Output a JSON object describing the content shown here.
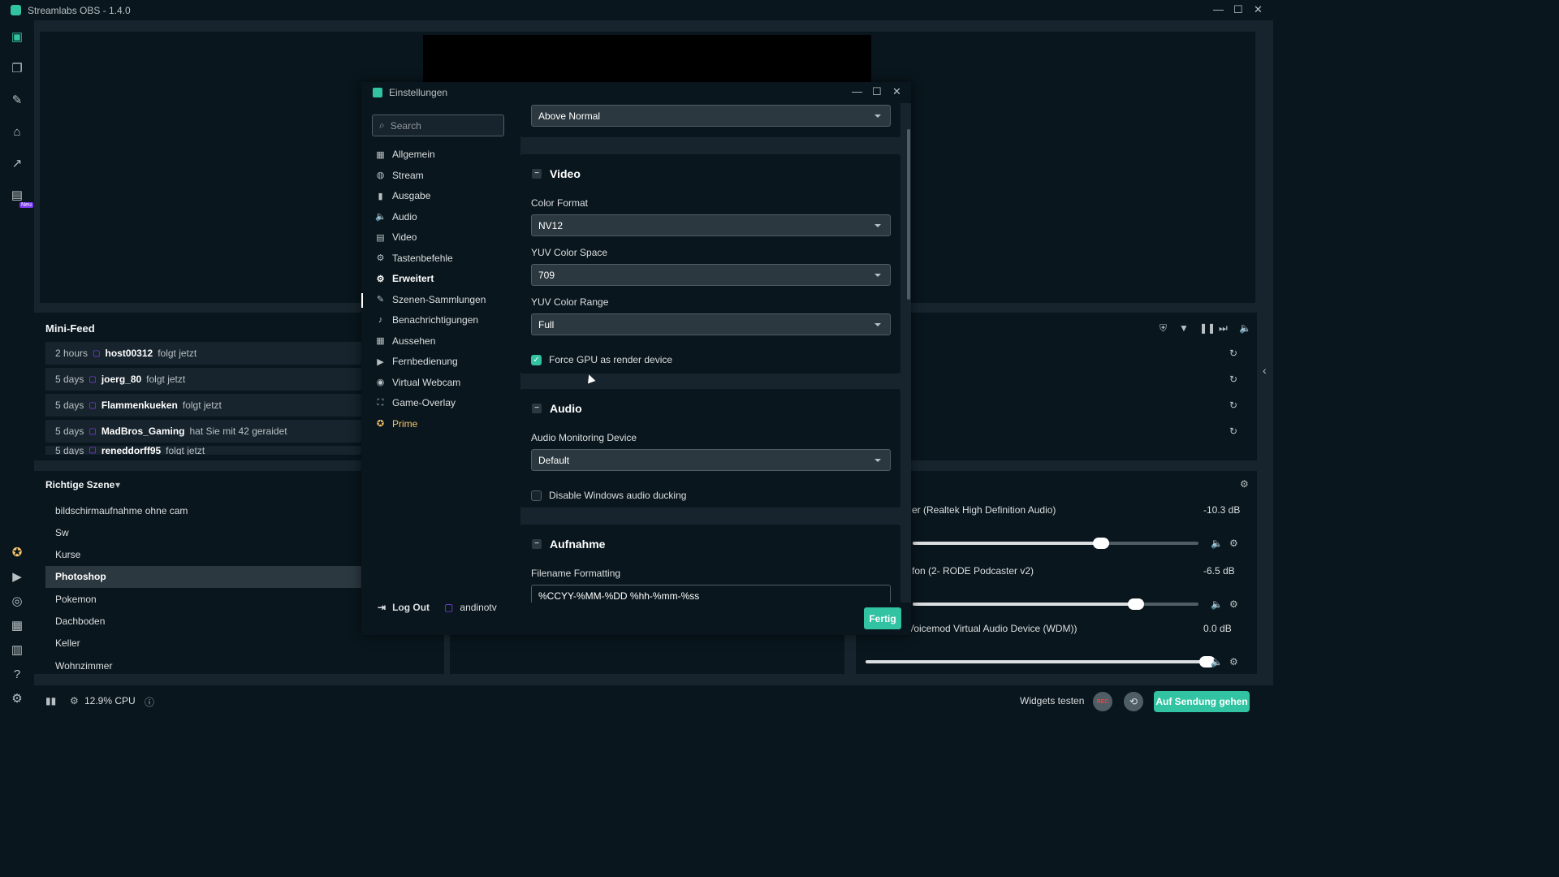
{
  "app": {
    "title": "Streamlabs OBS - 1.4.0"
  },
  "leftbar": {
    "new_badge": "Neu"
  },
  "minifeed": {
    "title": "Mini-Feed",
    "rows": [
      {
        "time": "2 hours",
        "user": "host00312",
        "action": "folgt jetzt"
      },
      {
        "time": "5 days",
        "user": "joerg_80",
        "action": "folgt jetzt"
      },
      {
        "time": "5 days",
        "user": "Flammenkueken",
        "action": "folgt jetzt"
      },
      {
        "time": "5 days",
        "user": "MadBros_Gaming",
        "action": "hat Sie mit 42 geraidet"
      },
      {
        "time": "5 days",
        "user": "reneddorff95",
        "action": "folgt jetzt"
      }
    ]
  },
  "scenes": {
    "title": "Richtige Szene",
    "items": [
      "bildschirmaufnahme ohne cam",
      "Sw",
      "Kurse",
      "Photoshop",
      "Pokemon",
      "Dachboden",
      "Keller",
      "Wohnzimmer"
    ],
    "active": "Photoshop"
  },
  "mixer": {
    "sources": [
      {
        "name": "er (Realtek High Definition Audio)",
        "db": "-10.3 dB",
        "level": 0.66
      },
      {
        "name": "fon (2- RODE Podcaster v2)",
        "db": "-6.5 dB",
        "level": 0.78
      },
      {
        "name": "Voicemod Virtual Audio Device (WDM))",
        "db": "0.0 dB",
        "level": 1.0
      }
    ]
  },
  "footer": {
    "cpu": "12.9% CPU",
    "widgets_test": "Widgets testen",
    "rec": "REC",
    "go_live": "Auf Sendung gehen"
  },
  "settings": {
    "title": "Einstellungen",
    "search_placeholder": "Search",
    "nav": [
      {
        "label": "Allgemein",
        "icon": "grid-icon"
      },
      {
        "label": "Stream",
        "icon": "globe-icon"
      },
      {
        "label": "Ausgabe",
        "icon": "output-icon"
      },
      {
        "label": "Audio",
        "icon": "speaker-icon"
      },
      {
        "label": "Video",
        "icon": "film-icon"
      },
      {
        "label": "Tastenbefehle",
        "icon": "gear-icon"
      },
      {
        "label": "Erweitert",
        "icon": "gears-icon"
      },
      {
        "label": "Szenen-Sammlungen",
        "icon": "tools-icon"
      },
      {
        "label": "Benachrichtigungen",
        "icon": "bell-icon"
      },
      {
        "label": "Aussehen",
        "icon": "layout-icon"
      },
      {
        "label": "Fernbedienung",
        "icon": "remote-icon"
      },
      {
        "label": "Virtual Webcam",
        "icon": "camera-icon"
      },
      {
        "label": "Game-Overlay",
        "icon": "overlay-icon"
      },
      {
        "label": "Prime",
        "icon": "prime-icon"
      }
    ],
    "active_nav": "Erweitert",
    "logout": "Log Out",
    "username": "andinotv",
    "process_priority_value": "Above Normal",
    "video": {
      "heading": "Video",
      "color_format_label": "Color Format",
      "color_format_value": "NV12",
      "yuv_space_label": "YUV Color Space",
      "yuv_space_value": "709",
      "yuv_range_label": "YUV Color Range",
      "yuv_range_value": "Full",
      "force_gpu_label": "Force GPU as render device",
      "force_gpu_checked": true
    },
    "audio": {
      "heading": "Audio",
      "monitoring_label": "Audio Monitoring Device",
      "monitoring_value": "Default",
      "ducking_label": "Disable Windows audio ducking",
      "ducking_checked": false
    },
    "recording": {
      "heading": "Aufnahme",
      "filename_label": "Filename Formatting",
      "filename_value": "%CCYY-%MM-%DD %hh-%mm-%ss"
    },
    "done_button": "Fertig"
  },
  "colors": {
    "accent": "#31c3a2",
    "bg_dark": "#09161d",
    "bg_panel": "#17242d",
    "prime": "#f7c56a"
  }
}
